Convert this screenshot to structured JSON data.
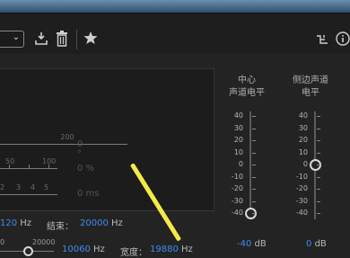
{
  "toolbar": {
    "icons": [
      "chevron-down-icon",
      "save-preset-icon",
      "trash-icon",
      "favorite-star-icon",
      "fork-routing-icon",
      "info-icon"
    ]
  },
  "ruler": {
    "degree": {
      "label": "200",
      "value": "0 °"
    },
    "percent": {
      "labels": [
        "50",
        "100"
      ],
      "value": "0 %"
    },
    "ms": {
      "labels": [
        "2",
        "3",
        "4",
        "5"
      ],
      "value": "0 ms"
    }
  },
  "freq_row": {
    "start_value": "120",
    "start_unit": "Hz",
    "end_label": "结束：",
    "end_value": "20000",
    "end_unit": "Hz"
  },
  "bandwidth_row": {
    "slider_labels": [
      "0",
      "20000"
    ],
    "center_value": "10060",
    "center_unit": "Hz",
    "width_label": "宽度：",
    "width_value": "19880",
    "width_unit": "Hz"
  },
  "center_channel": {
    "title_line1": "中心",
    "title_line2": "声道电平",
    "scale": [
      "40",
      "30",
      "20",
      "10",
      "0",
      "-10",
      "-20",
      "-30",
      "-40"
    ],
    "level_value": "-40",
    "level_unit": "dB",
    "level_db": -40
  },
  "side_channel": {
    "title_line1": "侧边声道",
    "title_line2": "电平",
    "scale": [
      "40",
      "30",
      "20",
      "10",
      "0",
      "-10",
      "-20",
      "-30",
      "-40"
    ],
    "level_value": "0",
    "level_unit": "dB",
    "level_db": 0
  },
  "colors": {
    "accent_blue": "#3e8cf0",
    "annotation_yellow": "#f3ea47"
  }
}
